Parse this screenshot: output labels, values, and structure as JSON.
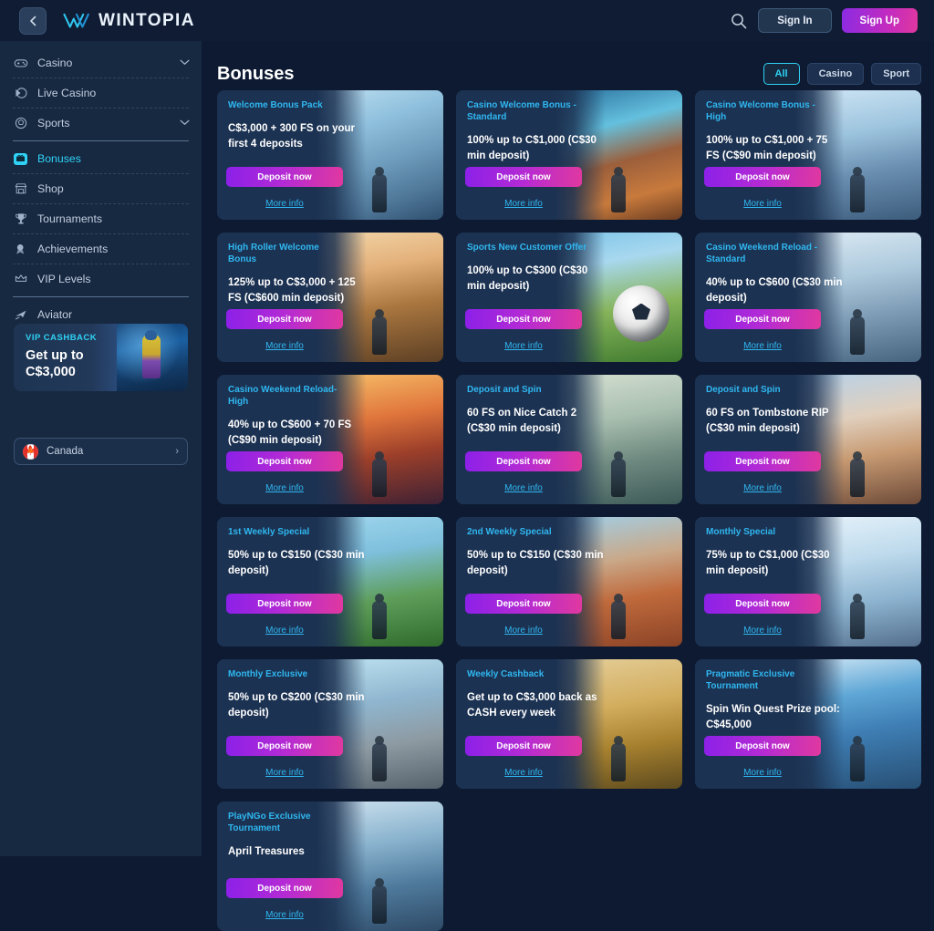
{
  "topbar": {
    "collapse_icon": "chevron-left-icon",
    "brand_name": "WINTOPIA",
    "search_icon": "search-icon",
    "sign_in_label": "Sign In",
    "sign_up_label": "Sign Up",
    "accent_purple": "#8c20e8",
    "accent_pink": "#e0389f"
  },
  "sidebar": {
    "items": [
      {
        "label": "Casino",
        "icon": "gamepad-icon",
        "chevron": "⌄",
        "active": false,
        "expandable": true
      },
      {
        "label": "Live Casino",
        "icon": "live-play-icon",
        "chevron": "",
        "active": false,
        "expandable": false
      },
      {
        "label": "Sports",
        "icon": "soccer-icon",
        "chevron": "⌄",
        "active": false,
        "expandable": true
      },
      {
        "label": "Bonuses",
        "icon": "gift-icon",
        "chevron": "",
        "active": true,
        "expandable": false
      },
      {
        "label": "Shop",
        "icon": "store-icon",
        "chevron": "",
        "active": false,
        "expandable": false
      },
      {
        "label": "Tournaments",
        "icon": "trophy-icon",
        "chevron": "",
        "active": false,
        "expandable": false
      },
      {
        "label": "Achievements",
        "icon": "medal-icon",
        "chevron": "",
        "active": false,
        "expandable": false
      },
      {
        "label": "VIP Levels",
        "icon": "crown-icon",
        "chevron": "",
        "active": false,
        "expandable": false
      },
      {
        "label": "Aviator",
        "icon": "plane-icon",
        "chevron": "",
        "active": false,
        "expandable": false
      }
    ],
    "vip_banner": {
      "label": "VIP CASHBACK",
      "headline_line1": "Get up to",
      "headline_line2": "C$3,000",
      "accent": "#2fd2f5"
    },
    "country": {
      "name": "Canada",
      "flag_icon": "canada-flag-icon",
      "chevron_icon": "chevron-right-icon"
    }
  },
  "main": {
    "page_title": "Bonuses",
    "filters": [
      {
        "label": "All",
        "active": true
      },
      {
        "label": "Casino",
        "active": false
      },
      {
        "label": "Sport",
        "active": false
      }
    ],
    "card_cta": "Deposit now",
    "card_link": "More info",
    "cards": [
      {
        "title": "Welcome Bonus Pack",
        "desc": "C$3,000 + 300 FS on your first 4 deposits",
        "art": "art-mtn-blue"
      },
      {
        "title": "Casino Welcome Bonus - Standard",
        "desc": "100% up to C$1,000 (C$30 min deposit)",
        "art": "art-fjord"
      },
      {
        "title": "Casino Welcome Bonus - High",
        "desc": "100% up to C$1,000 + 75 FS (C$90 min deposit)",
        "art": "art-snowman"
      },
      {
        "title": "High Roller Welcome Bonus",
        "desc": "125% up to C$3,000 + 125 FS (C$600 min deposit)",
        "art": "art-sunrise"
      },
      {
        "title": "Sports New Customer Offer",
        "desc": "100% up to C$300 (C$30 min deposit)",
        "art": "art-soccer"
      },
      {
        "title": "Casino Weekend Reload - Standard",
        "desc": "40% up to C$600 (C$30 min deposit)",
        "art": "art-ridge"
      },
      {
        "title": "Casino Weekend Reload-High",
        "desc": "40% up to C$600 + 70 FS (C$90 min deposit)",
        "art": "art-sunsetmtn"
      },
      {
        "title": "Deposit and Spin",
        "desc": "60 FS on Nice Catch 2 (C$30 min deposit)",
        "art": "art-bridge"
      },
      {
        "title": "Deposit and Spin",
        "desc": "60 FS on Tombstone RIP (C$30 min deposit)",
        "art": "art-clouds"
      },
      {
        "title": "1st Weekly Special",
        "desc": "50% up to C$150 (C$30 min deposit)",
        "art": "art-field"
      },
      {
        "title": "2nd Weekly Special",
        "desc": "50% up to C$150 (C$30 min deposit)",
        "art": "art-tennis"
      },
      {
        "title": "Monthly Special",
        "desc": "75% up to C$1,000 (C$30 min deposit)",
        "art": "art-ice"
      },
      {
        "title": "Monthly Exclusive",
        "desc": "50% up to C$200 (C$30 min deposit)",
        "art": "art-basket"
      },
      {
        "title": "Weekly Cashback",
        "desc": "Get up to C$3,000 back as CASH every week",
        "art": "art-coins"
      },
      {
        "title": "Pragmatic Exclusive Tournament",
        "desc": "Spin Win Quest Prize pool: C$45,000",
        "art": "art-flag"
      },
      {
        "title": "PlayNGo Exclusive Tournament",
        "desc": "April Treasures",
        "art": "art-waterfall"
      }
    ]
  }
}
